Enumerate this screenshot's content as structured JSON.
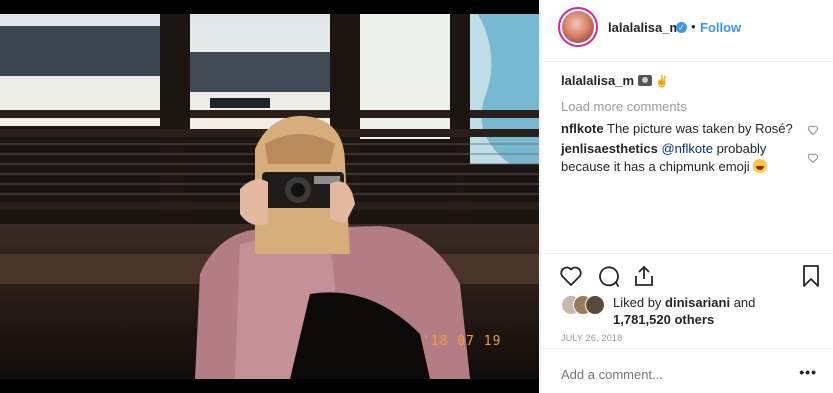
{
  "post": {
    "username": "lalalalisa_m",
    "follow_label": "Follow",
    "separator": "•",
    "photo_stamp": "'18 07 19",
    "caption_user": "lalalalisa_m",
    "load_more": "Load more comments",
    "comments": [
      {
        "user": "nflkote",
        "text": "The picture was taken by Rosé?"
      },
      {
        "user": "jenlisaesthetics",
        "mention": "@nflkote",
        "text": " probably because it has a chipmunk emoji"
      }
    ],
    "likes": {
      "prefix": "Liked by ",
      "by_user": "dinisariani",
      "and_label": " and",
      "count_text": "1,781,520 others"
    },
    "date": "JULY 26, 2018",
    "add_comment_placeholder": "Add a comment...",
    "more_label": "•••"
  },
  "icons": [
    "verified-icon",
    "camera-emoji-icon",
    "hand-emoji-icon",
    "heart-icon",
    "comment-icon",
    "share-icon",
    "bookmark-icon",
    "laughing-emoji-icon",
    "more-icon"
  ],
  "colors": {
    "accent": "#3897f0",
    "muted": "#999999",
    "border": "#efefef",
    "mention": "#003569"
  }
}
